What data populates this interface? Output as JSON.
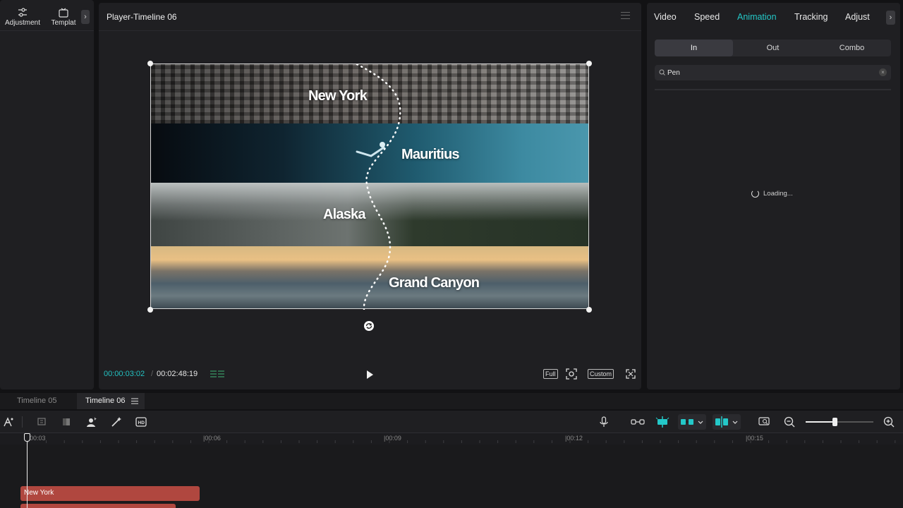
{
  "left_panel": {
    "tools": [
      {
        "label": "Adjustment",
        "icon": "sliders-icon"
      },
      {
        "label": "Templat",
        "icon": "template-icon"
      }
    ]
  },
  "player": {
    "title": "Player-Timeline 06",
    "cities": [
      "New York",
      "Mauritius",
      "Alaska",
      "Grand Canyon"
    ],
    "current_time": "00:00:03:02",
    "separator": "/",
    "total_time": "00:02:48:19",
    "full_label": "Full",
    "custom_label": "Custom"
  },
  "right_panel": {
    "tabs": [
      "Video",
      "Speed",
      "Animation",
      "Tracking",
      "Adjust"
    ],
    "active_tab": "Animation",
    "segments": [
      "In",
      "Out",
      "Combo"
    ],
    "selected_segment": "In",
    "search_value": "Pen",
    "loading_text": "Loading..."
  },
  "timeline": {
    "tabs": [
      "Timeline 05",
      "Timeline 06"
    ],
    "active_tab": "Timeline 06",
    "ruler": [
      "00:03",
      "|00:06",
      "|00:09",
      "|00:12",
      "|00:15"
    ],
    "clip_label": "New York"
  },
  "colors": {
    "accent": "#24c8c8",
    "clip": "#b0473f"
  }
}
